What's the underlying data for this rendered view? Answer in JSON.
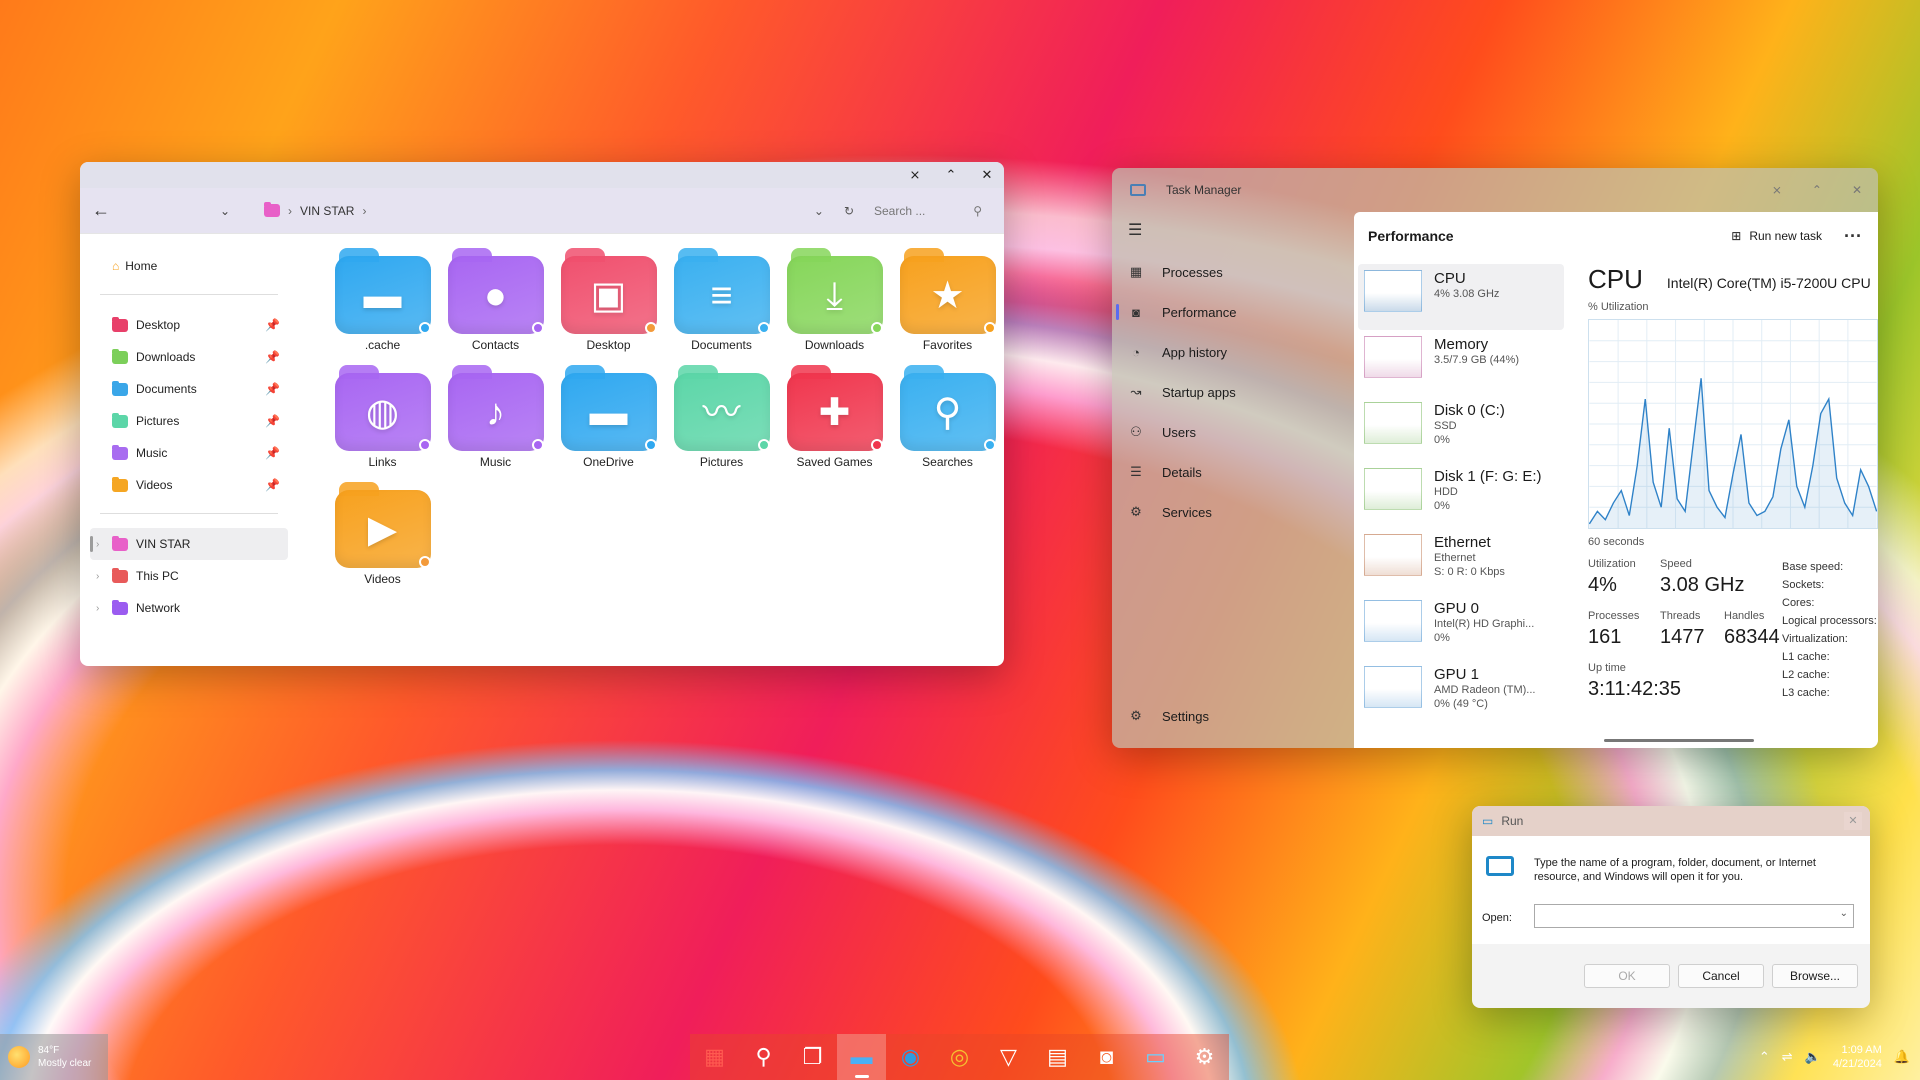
{
  "explorer": {
    "address": {
      "back": "←",
      "history": "⌄",
      "path": [
        "VIN STAR"
      ],
      "search_placeholder": "Search ...",
      "refresh": "↻",
      "dropdown": "⌄"
    },
    "controls": {
      "minimize": "⨯",
      "maximize": "⌃",
      "close": "✕"
    },
    "nav": {
      "home": "Home",
      "quick": [
        {
          "label": "Desktop",
          "color": "#e8406a"
        },
        {
          "label": "Downloads",
          "color": "#7ccf5a"
        },
        {
          "label": "Documents",
          "color": "#3aa6e8"
        },
        {
          "label": "Pictures",
          "color": "#5cd6a8"
        },
        {
          "label": "Music",
          "color": "#a86cf0"
        },
        {
          "label": "Videos",
          "color": "#f5a623"
        }
      ],
      "tree": [
        {
          "label": "VIN STAR",
          "color": "#e860c8"
        },
        {
          "label": "This PC",
          "color": "#e85a5a"
        },
        {
          "label": "Network",
          "color": "#9b5cf0"
        }
      ]
    },
    "folders": [
      {
        "label": ".cache",
        "color": "#2fa8f0",
        "glyph": "▬",
        "dot": "#2fa8f0"
      },
      {
        "label": "Contacts",
        "color": "#a866f2",
        "glyph": "●",
        "dot": "#a866f2"
      },
      {
        "label": "Desktop",
        "color": "#f0506e",
        "glyph": "▣",
        "dot": "#f39a3a"
      },
      {
        "label": "Documents",
        "color": "#3ab0f0",
        "glyph": "≡",
        "dot": "#3ab0f0"
      },
      {
        "label": "Downloads",
        "color": "#86d65a",
        "glyph": "⤓",
        "dot": "#86d65a"
      },
      {
        "label": "Favorites",
        "color": "#f7a11e",
        "glyph": "★",
        "dot": "#f7a11e"
      },
      {
        "label": "Links",
        "color": "#a866f2",
        "glyph": "◍",
        "dot": "#a866f2"
      },
      {
        "label": "Music",
        "color": "#a866f2",
        "glyph": "♪",
        "dot": "#a866f2"
      },
      {
        "label": "OneDrive",
        "color": "#2fa8f0",
        "glyph": "▬",
        "dot": "#2fa8f0"
      },
      {
        "label": "Pictures",
        "color": "#5cd6a8",
        "glyph": "〰",
        "dot": "#5cd6a8"
      },
      {
        "label": "Saved Games",
        "color": "#f0364e",
        "glyph": "✚",
        "dot": "#f0364e"
      },
      {
        "label": "Searches",
        "color": "#3ab0f0",
        "glyph": "⚲",
        "dot": "#3ab0f0"
      },
      {
        "label": "Videos",
        "color": "#f7a11e",
        "glyph": "▶",
        "dot": "#f39a3a"
      }
    ]
  },
  "taskmgr": {
    "title": "Task Manager",
    "nav": [
      {
        "label": "Processes",
        "icon": "▦"
      },
      {
        "label": "Performance",
        "icon": "◙"
      },
      {
        "label": "App history",
        "icon": "◔"
      },
      {
        "label": "Startup apps",
        "icon": "↝"
      },
      {
        "label": "Users",
        "icon": "⚇"
      },
      {
        "label": "Details",
        "icon": "☰"
      },
      {
        "label": "Services",
        "icon": "⚙"
      }
    ],
    "settings": "Settings",
    "panel_title": "Performance",
    "run_new_task": "Run new task",
    "more": "···",
    "resources": [
      {
        "name": "CPU",
        "sub1": "4% 3.08 GHz",
        "sub2": "",
        "sub3": "",
        "color": "#2f82c8"
      },
      {
        "name": "Memory",
        "sub1": "3.5/7.9 GB (44%)",
        "sub2": "",
        "sub3": "",
        "color": "#b0468c"
      },
      {
        "name": "Disk 0 (C:)",
        "sub1": "SSD",
        "sub2": "0%",
        "sub3": "",
        "color": "#5aa83a"
      },
      {
        "name": "Disk 1 (F: G: E:)",
        "sub1": "HDD",
        "sub2": "0%",
        "sub3": "",
        "color": "#5aa83a"
      },
      {
        "name": "Ethernet",
        "sub1": "Ethernet",
        "sub2": "S: 0 R: 0 Kbps",
        "sub3": "",
        "color": "#b05a2a"
      },
      {
        "name": "GPU 0",
        "sub1": "Intel(R) HD Graphi...",
        "sub2": "0%",
        "sub3": "",
        "color": "#2f82c8"
      },
      {
        "name": "GPU 1",
        "sub1": "AMD Radeon (TM)...",
        "sub2": "0% (49 °C)",
        "sub3": "",
        "color": "#2f82c8"
      }
    ],
    "cpu": {
      "title": "CPU",
      "model": "Intel(R) Core(TM) i5-7200U CPU",
      "util_label": "% Utilization",
      "time_label": "60 seconds",
      "graph_values": [
        2,
        8,
        4,
        12,
        18,
        6,
        30,
        62,
        22,
        10,
        48,
        14,
        8,
        40,
        72,
        18,
        10,
        5,
        26,
        45,
        12,
        6,
        8,
        15,
        38,
        52,
        20,
        10,
        30,
        55,
        62,
        24,
        12,
        6,
        28,
        20,
        8
      ],
      "stats": {
        "utilization_label": "Utilization",
        "utilization": "4%",
        "speed_label": "Speed",
        "speed": "3.08 GHz",
        "processes_label": "Processes",
        "processes": "161",
        "threads_label": "Threads",
        "threads": "1477",
        "handles_label": "Handles",
        "handles": "68344",
        "uptime_label": "Up time",
        "uptime": "3:11:42:35"
      },
      "specs": [
        "Base speed:",
        "Sockets:",
        "Cores:",
        "Logical processors:",
        "Virtualization:",
        "L1 cache:",
        "L2 cache:",
        "L3 cache:"
      ]
    },
    "controls": {
      "minimize": "⨯",
      "maximize": "⌃",
      "close": "✕"
    }
  },
  "run": {
    "title": "Run",
    "description": "Type the name of a program, folder, document, or Internet resource, and Windows will open it for you.",
    "open_label": "Open:",
    "input_value": "",
    "ok": "OK",
    "cancel": "Cancel",
    "browse": "Browse...",
    "close": "✕"
  },
  "taskbar": {
    "weather_temp": "84°F",
    "weather_desc": "Mostly clear",
    "apps": [
      {
        "name": "start",
        "glyph": "▦",
        "color": "#ff5a50"
      },
      {
        "name": "search",
        "glyph": "⚲",
        "color": "#ffffff"
      },
      {
        "name": "task-view",
        "glyph": "❐",
        "color": "#ffffff"
      },
      {
        "name": "file-explorer",
        "glyph": "▬",
        "color": "#4ab0f5"
      },
      {
        "name": "edge",
        "glyph": "◉",
        "color": "#2f9be0"
      },
      {
        "name": "chrome",
        "glyph": "◎",
        "color": "#f5c030"
      },
      {
        "name": "vivaldi",
        "glyph": "▽",
        "color": "#ffffff"
      },
      {
        "name": "store",
        "glyph": "▤",
        "color": "#ffffff"
      },
      {
        "name": "task-manager",
        "glyph": "◙",
        "color": "#ffffff"
      },
      {
        "name": "run",
        "glyph": "▭",
        "color": "#6ad0ff"
      },
      {
        "name": "settings",
        "glyph": "⚙",
        "color": "#ffffff"
      }
    ],
    "time": "1:09 AM",
    "date": "4/21/2024"
  }
}
